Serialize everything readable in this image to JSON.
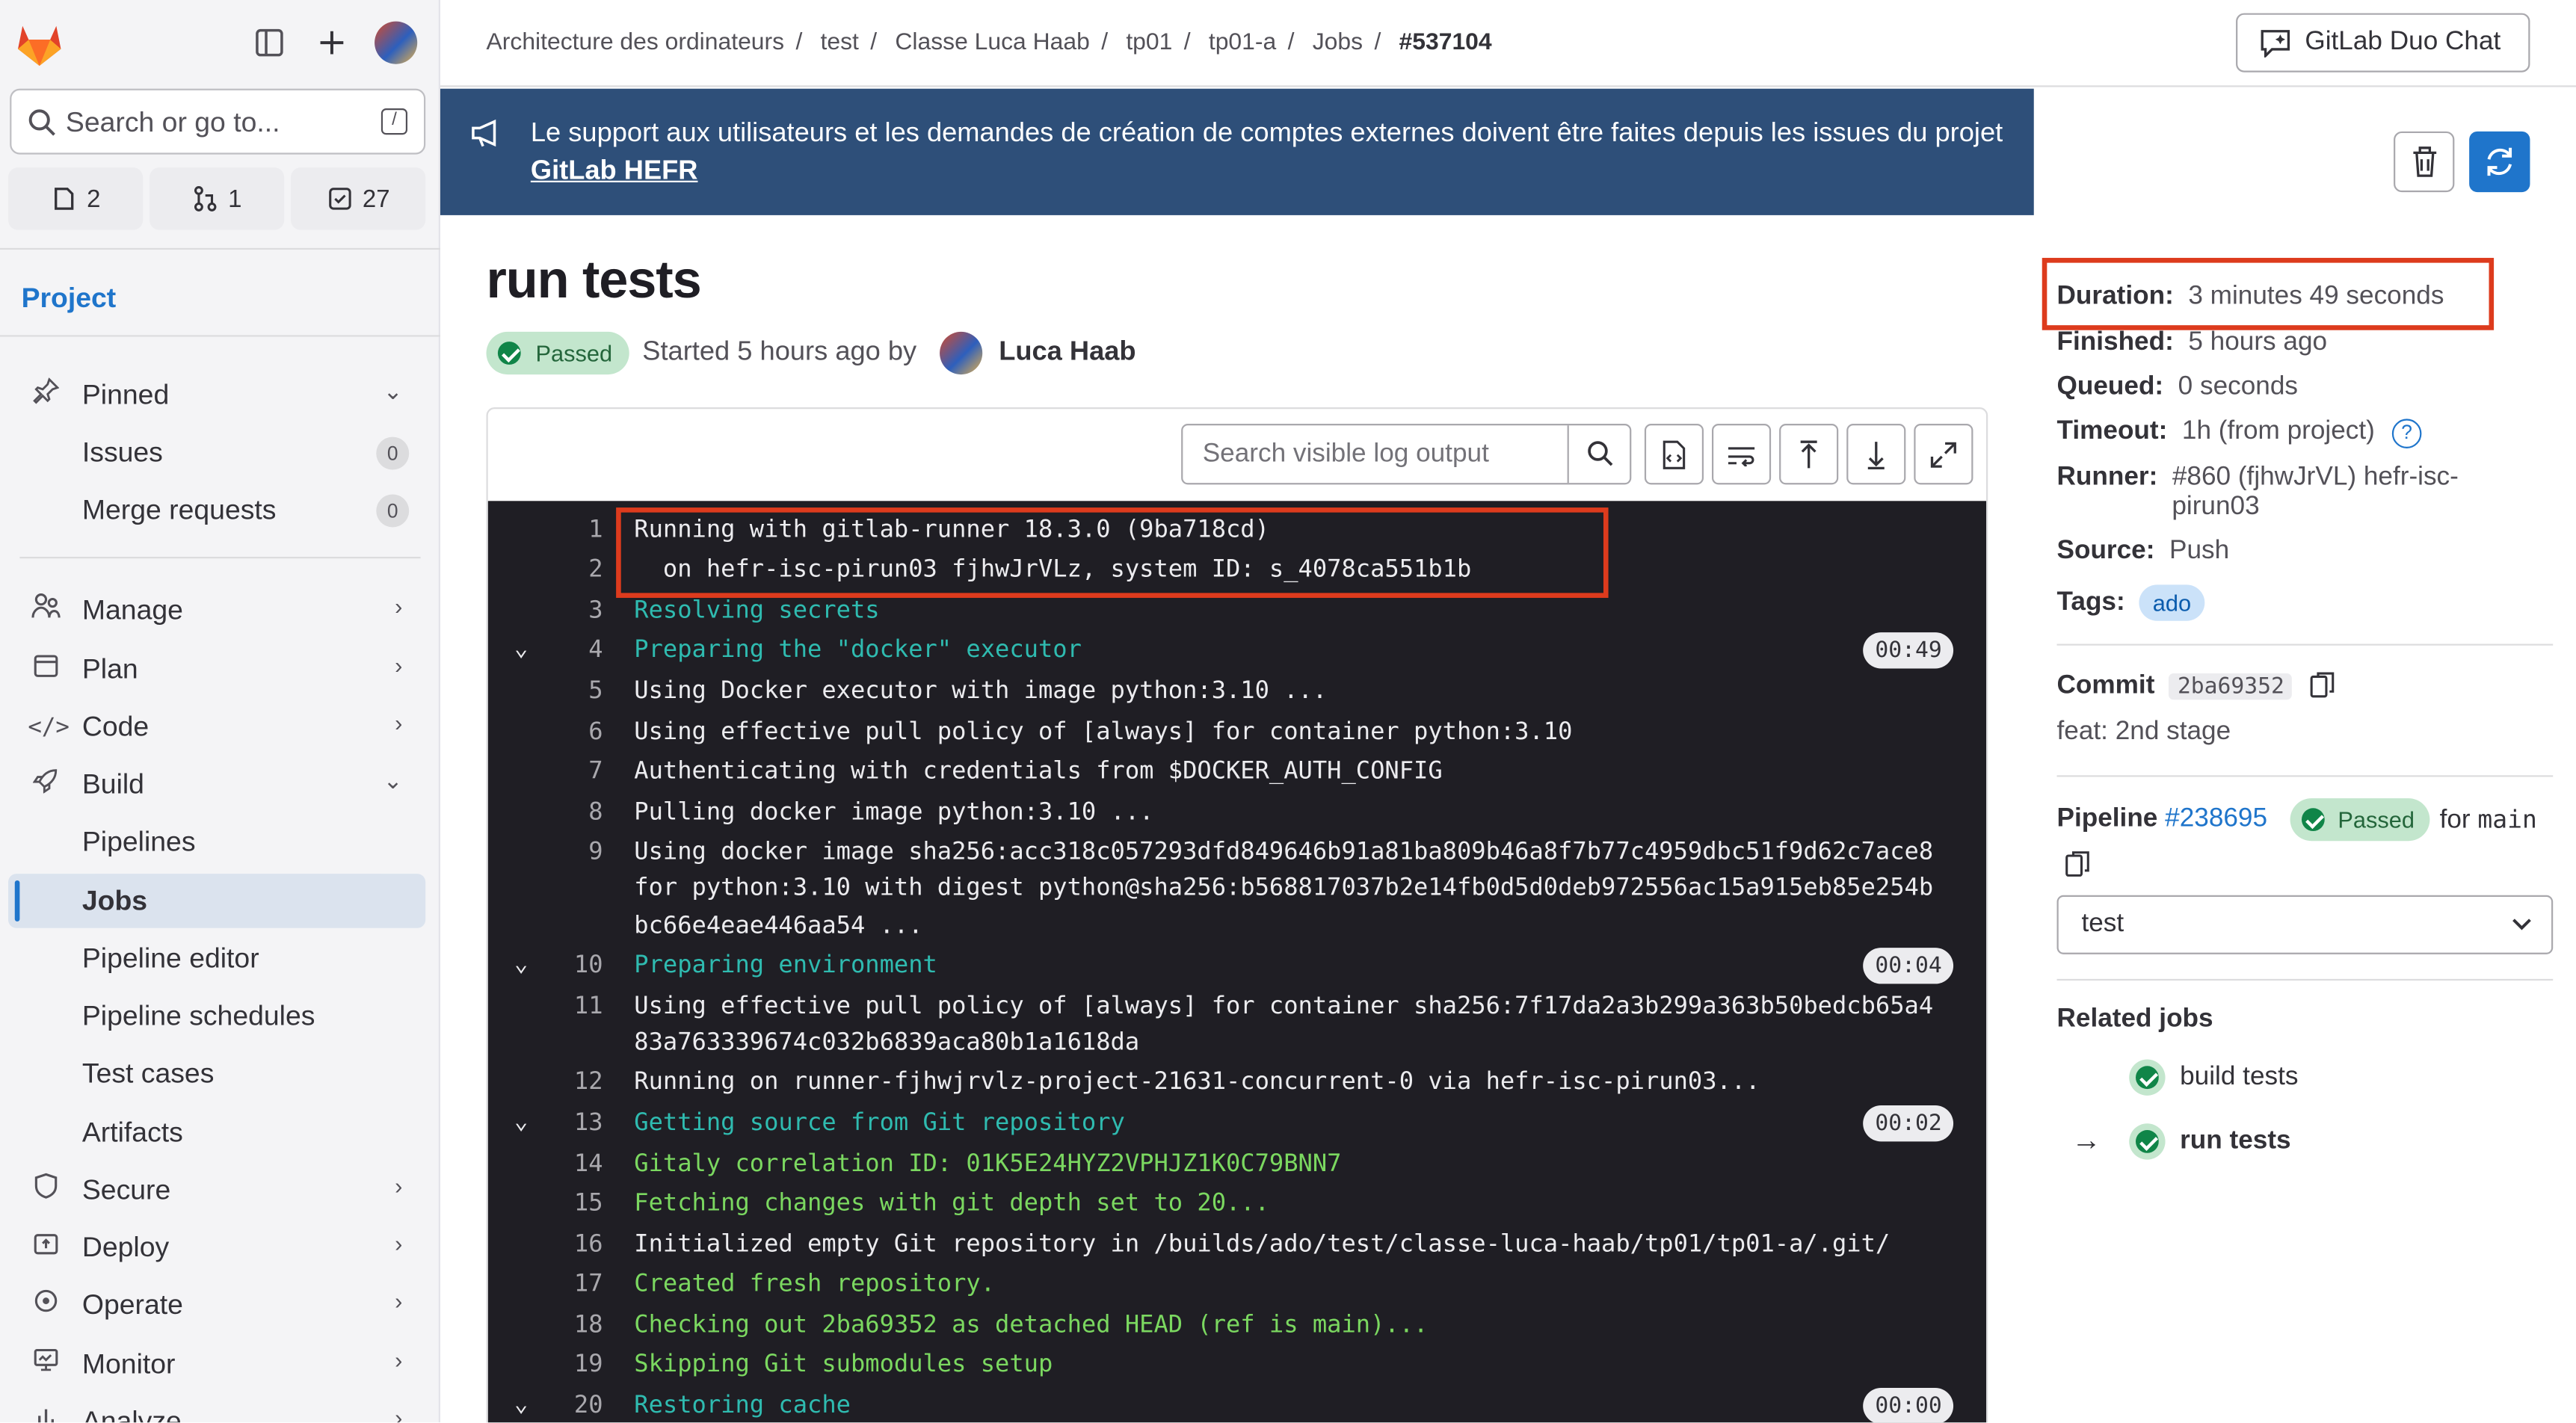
{
  "sidebar": {
    "search_placeholder": "Search or go to...",
    "search_shortcut": "/",
    "counts": {
      "issues": "2",
      "merge_requests": "1",
      "todos": "27"
    },
    "section_title": "Project",
    "items": {
      "pinned": "Pinned",
      "issues": "Issues",
      "issues_count": "0",
      "merge_requests": "Merge requests",
      "merge_requests_count": "0",
      "manage": "Manage",
      "plan": "Plan",
      "code": "Code",
      "build": "Build",
      "pipelines": "Pipelines",
      "jobs": "Jobs",
      "pipeline_editor": "Pipeline editor",
      "pipeline_schedules": "Pipeline schedules",
      "test_cases": "Test cases",
      "artifacts": "Artifacts",
      "secure": "Secure",
      "deploy": "Deploy",
      "operate": "Operate",
      "monitor": "Monitor",
      "analyze": "Analyze"
    }
  },
  "breadcrumb": [
    "Architecture des ordinateurs",
    "test",
    "Classe Luca Haab",
    "tp01",
    "tp01-a",
    "Jobs",
    "#537104"
  ],
  "header": {
    "duo_chat": "GitLab Duo Chat"
  },
  "banner": {
    "text": "Le support aux utilisateurs et les demandes de création de comptes externes doivent être faites depuis les issues du projet ",
    "link": "GitLab HEFR"
  },
  "job": {
    "title": "run tests",
    "status": "Passed",
    "started": "Started 5 hours ago by",
    "author": "Luca Haab"
  },
  "log": {
    "search_placeholder": "Search visible log output",
    "lines": [
      {
        "n": "1",
        "text": "Running with gitlab-runner 18.3.0 (9ba718cd)",
        "cls": "w"
      },
      {
        "n": "2",
        "text": "  on hefr-isc-pirun03 fjhwJrVLz, system ID: s_4078ca551b1b",
        "cls": "w"
      },
      {
        "n": "3",
        "text": "Resolving secrets",
        "cls": "c"
      },
      {
        "n": "4",
        "text": "Preparing the \"docker\" executor",
        "cls": "c",
        "time": "00:49"
      },
      {
        "n": "5",
        "text": "Using Docker executor with image python:3.10 ...",
        "cls": "w"
      },
      {
        "n": "6",
        "text": "Using effective pull policy of [always] for container python:3.10",
        "cls": "w"
      },
      {
        "n": "7",
        "text": "Authenticating with credentials from $DOCKER_AUTH_CONFIG",
        "cls": "w"
      },
      {
        "n": "8",
        "text": "Pulling docker image python:3.10 ...",
        "cls": "w"
      },
      {
        "n": "9",
        "text": "Using docker image sha256:acc318c057293dfd849646b91a81ba809b46a8f7b77c4959dbc51f9d62c7ace8",
        "cls": "w"
      },
      {
        "n": "",
        "text": "for python:3.10 with digest python@sha256:b568817037b2e14fb0d5d0deb972556ac15a915eb85e254b",
        "cls": "w"
      },
      {
        "n": "",
        "text": "bc66e4eae446aa54 ...",
        "cls": "w"
      },
      {
        "n": "10",
        "text": "Preparing environment",
        "cls": "c",
        "time": "00:04"
      },
      {
        "n": "11",
        "text": "Using effective pull policy of [always] for container sha256:7f17da2a3b299a363b50bedcb65a4",
        "cls": "w"
      },
      {
        "n": "",
        "text": "83a763339674c032b6839aca80b1a1618da",
        "cls": "w"
      },
      {
        "n": "12",
        "text": "Running on runner-fjhwjrvlz-project-21631-concurrent-0 via hefr-isc-pirun03...",
        "cls": "w"
      },
      {
        "n": "13",
        "text": "Getting source from Git repository",
        "cls": "c",
        "time": "00:02"
      },
      {
        "n": "14",
        "text": "Gitaly correlation ID: 01K5E24HYZ2VPHJZ1K0C79BNN7",
        "cls": "g"
      },
      {
        "n": "15",
        "text": "Fetching changes with git depth set to 20...",
        "cls": "g"
      },
      {
        "n": "16",
        "text": "Initialized empty Git repository in /builds/ado/test/classe-luca-haab/tp01/tp01-a/.git/",
        "cls": "w"
      },
      {
        "n": "17",
        "text": "Created fresh repository.",
        "cls": "g"
      },
      {
        "n": "18",
        "text": "Checking out 2ba69352 as detached HEAD (ref is main)...",
        "cls": "g"
      },
      {
        "n": "19",
        "text": "Skipping Git submodules setup",
        "cls": "g"
      },
      {
        "n": "20",
        "text": "Restoring cache",
        "cls": "c",
        "time": "00:00"
      }
    ]
  },
  "details": {
    "duration_label": "Duration:",
    "duration": "3 minutes 49 seconds",
    "finished_label": "Finished:",
    "finished": "5 hours ago",
    "queued_label": "Queued:",
    "queued": "0 seconds",
    "timeout_label": "Timeout:",
    "timeout": "1h (from project)",
    "runner_label": "Runner:",
    "runner": "#860 (fjhwJrVL) hefr-isc-",
    "runner_cont": "pirun03",
    "source_label": "Source:",
    "source": "Push",
    "tags_label": "Tags:",
    "tag": "ado",
    "commit_label": "Commit",
    "commit_sha": "2ba69352",
    "commit_msg": "feat: 2nd stage",
    "pipeline_label": "Pipeline",
    "pipeline_id": "#238695",
    "pipeline_status": "Passed",
    "pipeline_for": "for",
    "pipeline_ref": "main",
    "stage_select": "test",
    "related_title": "Related jobs",
    "related": [
      "build tests",
      "run tests"
    ]
  },
  "colors": {
    "accent": "#1f75cb",
    "banner": "#2e4f79",
    "highlight": "#dd3b1d",
    "success": "#108548"
  }
}
